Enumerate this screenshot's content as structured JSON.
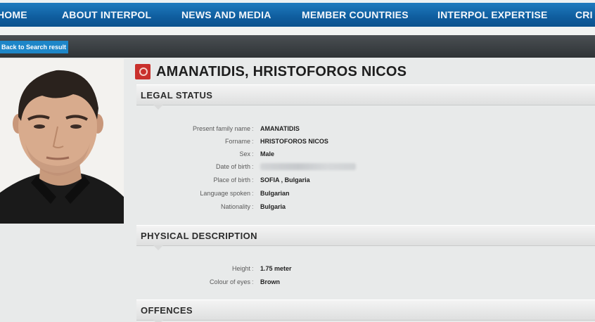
{
  "nav": {
    "items": [
      "HOME",
      "ABOUT INTERPOL",
      "NEWS AND MEDIA",
      "MEMBER COUNTRIES",
      "INTERPOL EXPERTISE",
      "CRI"
    ]
  },
  "back_button": "Back to Search result",
  "profile": {
    "name": "AMANATIDIS, HRISTOFOROS NICOS"
  },
  "legal_status": {
    "heading": "LEGAL STATUS",
    "fields": [
      {
        "label": "Present family name",
        "value": "AMANATIDIS"
      },
      {
        "label": "Forname",
        "value": "HRISTOFOROS NICOS"
      },
      {
        "label": "Sex",
        "value": "Male"
      },
      {
        "label": "Date of birth",
        "value": ""
      },
      {
        "label": "Place of birth",
        "value": "SOFIA , Bulgaria"
      },
      {
        "label": "Language spoken",
        "value": "Bulgarian"
      },
      {
        "label": "Nationality",
        "value": "Bulgaria"
      }
    ]
  },
  "physical_description": {
    "heading": "PHYSICAL DESCRIPTION",
    "fields": [
      {
        "label": "Height",
        "value": "1.75 meter"
      },
      {
        "label": "Colour of eyes",
        "value": "Brown"
      }
    ]
  },
  "offences": {
    "heading": "OFFENCES"
  },
  "colors": {
    "nav_blue": "#0f5d9e",
    "back_button_blue": "#1d86c8",
    "title_icon_red": "#c9302c"
  }
}
